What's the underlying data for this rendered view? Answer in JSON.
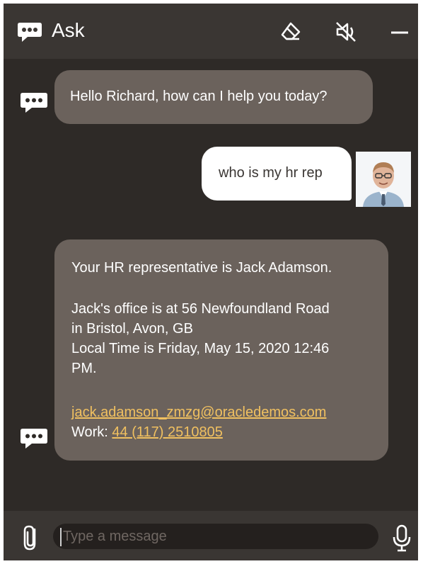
{
  "header": {
    "title": "Ask",
    "icons": [
      "chat-bot-icon",
      "eraser-icon",
      "mute-icon",
      "minimize-icon"
    ]
  },
  "conversation": {
    "greeting": "Hello Richard, how can I help you today?",
    "user_message": "who is my hr rep",
    "response": {
      "line1": "Your HR representative is Jack Adamson.",
      "line2": "Jack's office is at 56 Newfoundland Road",
      "line3": "in Bristol, Avon, GB",
      "line4": "Local Time is Friday, May 15, 2020 12:46",
      "line5": "PM.",
      "email": "jack.adamson_zmzg@oracledemos.com",
      "work_label": "Work: ",
      "work_phone": "44 (117) 2510805"
    }
  },
  "composer": {
    "placeholder": "Type a message"
  },
  "colors": {
    "header_bg": "#3a3633",
    "conversation_bg": "#2e2a27",
    "bot_bubble": "#6b625c",
    "user_bubble": "#ffffff",
    "link": "#f0c060"
  }
}
